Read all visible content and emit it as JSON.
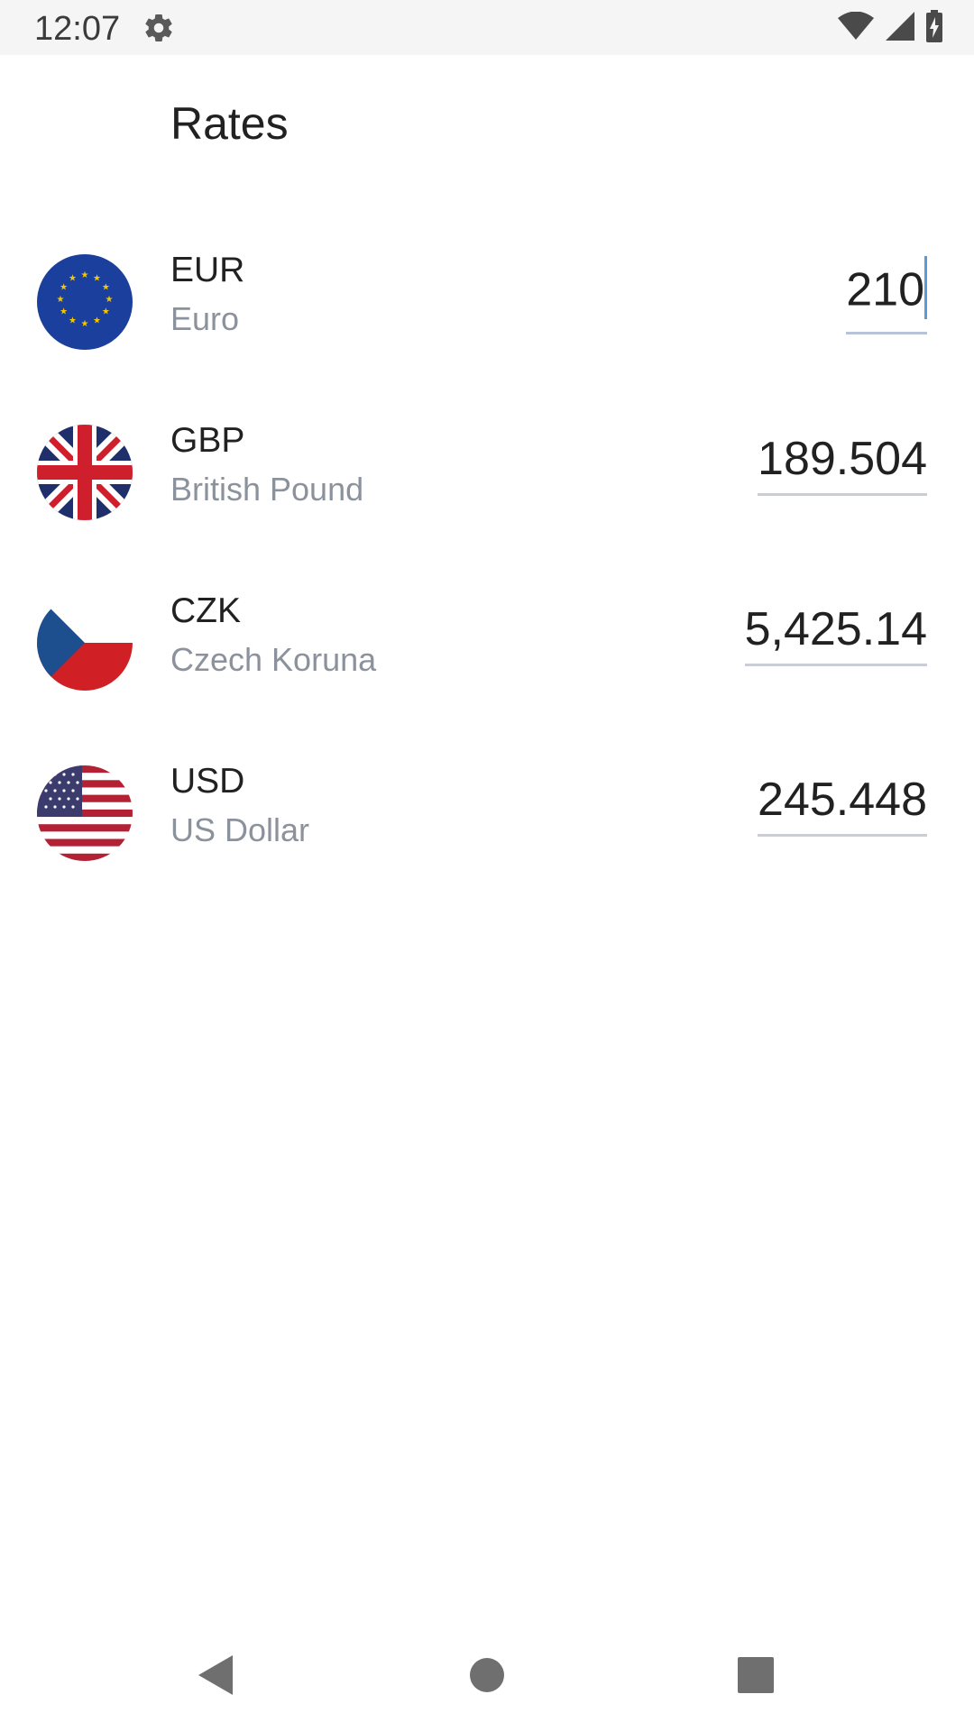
{
  "status_bar": {
    "time": "12:07"
  },
  "title": "Rates",
  "rates": [
    {
      "code": "EUR",
      "name": "Euro",
      "amount": "210",
      "flag": "eu-flag"
    },
    {
      "code": "GBP",
      "name": "British Pound",
      "amount": "189.504",
      "flag": "uk-flag"
    },
    {
      "code": "CZK",
      "name": "Czech Koruna",
      "amount": "5,425.14",
      "flag": "czech-flag"
    },
    {
      "code": "USD",
      "name": "US Dollar",
      "amount": "245.448",
      "flag": "us-flag"
    }
  ],
  "colors": {
    "eu_blue": "#1a3f9d",
    "eu_star": "#f6c400",
    "uk_blue": "#1e2f6b",
    "uk_red": "#cf1f2c",
    "cz_blue": "#1d4f8f",
    "cz_red": "#d11f26",
    "us_red": "#b22234",
    "us_blue": "#3c3b6e"
  }
}
